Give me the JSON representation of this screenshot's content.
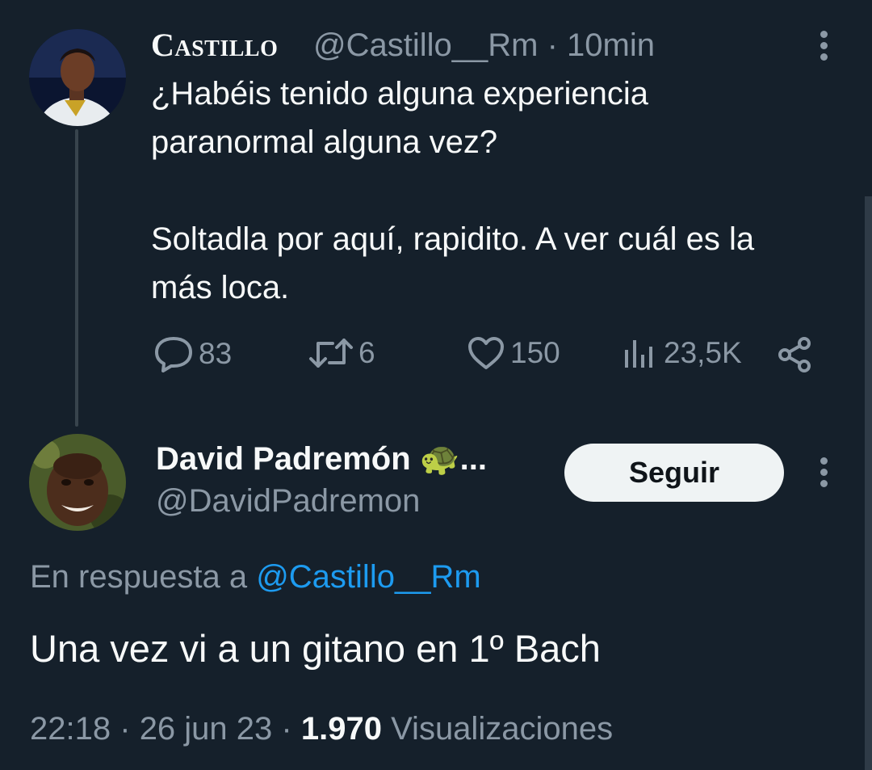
{
  "original_tweet": {
    "display_name": "Castillo",
    "handle": "@Castillo__Rm",
    "separator": "·",
    "time": "10min",
    "text": "¿Habéis tenido alguna experiencia\nparanormal alguna vez?\n\nSoltadla por aquí, rapidito. A ver cuál es la\nmás loca.",
    "replies": "83",
    "retweets": "6",
    "likes": "150",
    "views": "23,5K",
    "icons": [
      "more-icon",
      "reply-icon",
      "retweet-icon",
      "like-icon",
      "views-icon",
      "share-icon"
    ]
  },
  "reply": {
    "display_name": "David Padremón",
    "name_emoji": "🐢",
    "name_ellipsis": "...",
    "handle": "@DavidPadremon",
    "follow_label": "Seguir",
    "reply_to_prefix": "En respuesta a",
    "reply_to_handle": "@Castillo__Rm",
    "text": "Una vez vi a un gitano en 1º Bach",
    "time": "22:18",
    "separator": "·",
    "date": "26 jun 23",
    "views_count": "1.970",
    "views_label": "Visualizaciones"
  },
  "colors": {
    "background": "#15202b",
    "text_primary": "#f7f9f9",
    "text_secondary": "#8b98a5",
    "link": "#1d9bf0",
    "follow_bg": "#eff3f4"
  }
}
